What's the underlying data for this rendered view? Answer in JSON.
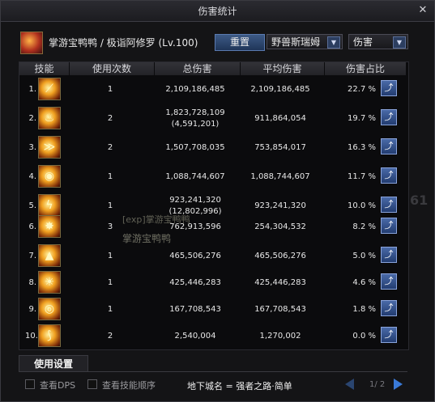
{
  "window": {
    "title": "伤害统计",
    "close": "✕"
  },
  "header": {
    "player": "掌游宝鸭鸭 / 极诣阿修罗 (Lv.100)",
    "reset_label": "重置",
    "dungeon_select": "野兽斯瑞姆",
    "type_select": "伤害"
  },
  "columns": [
    "技能",
    "使用次数",
    "总伤害",
    "平均伤害",
    "伤害占比"
  ],
  "rows": [
    {
      "rank": "1.",
      "uses": "1",
      "total": "2,109,186,485",
      "total_sub": "",
      "avg": "2,109,186,485",
      "pct": "22.7 %",
      "icon": "slash-icon"
    },
    {
      "rank": "2.",
      "uses": "2",
      "total": "1,823,728,109",
      "total_sub": "(4,591,201)",
      "avg": "911,864,054",
      "pct": "19.7 %",
      "icon": "flame-icon"
    },
    {
      "rank": "3.",
      "uses": "2",
      "total": "1,507,708,035",
      "total_sub": "",
      "avg": "753,854,017",
      "pct": "16.3 %",
      "icon": "wave-icon"
    },
    {
      "rank": "4.",
      "uses": "1",
      "total": "1,088,744,607",
      "total_sub": "",
      "avg": "1,088,744,607",
      "pct": "11.7 %",
      "icon": "eye-icon"
    },
    {
      "rank": "5.",
      "uses": "1",
      "total": "923,241,320",
      "total_sub": "(12,802,996)",
      "avg": "923,241,320",
      "pct": "10.0 %",
      "icon": "lightning-icon"
    },
    {
      "rank": "6.",
      "uses": "3",
      "total": "762,913,596",
      "total_sub": "",
      "avg": "254,304,532",
      "pct": "8.2 %",
      "icon": "burst-icon"
    },
    {
      "rank": "7.",
      "uses": "1",
      "total": "465,506,276",
      "total_sub": "",
      "avg": "465,506,276",
      "pct": "5.0 %",
      "icon": "pillar-icon"
    },
    {
      "rank": "8.",
      "uses": "1",
      "total": "425,446,283",
      "total_sub": "",
      "avg": "425,446,283",
      "pct": "4.6 %",
      "icon": "sun-icon"
    },
    {
      "rank": "9.",
      "uses": "1",
      "total": "167,708,543",
      "total_sub": "",
      "avg": "167,708,543",
      "pct": "1.8 %",
      "icon": "vortex-icon"
    },
    {
      "rank": "10.",
      "uses": "2",
      "total": "2,540,004",
      "total_sub": "",
      "avg": "1,270,002",
      "pct": "0.0 %",
      "icon": "blade-icon"
    }
  ],
  "background": {
    "label1": "[exp]掌游宝鸭鸭",
    "label2": "掌游宝鸭鸭",
    "num": "61"
  },
  "footer": {
    "settings_tab": "使用设置",
    "show_dps": "查看DPS",
    "show_order": "查看技能顺序",
    "dungeon_info": "地下城名 = 强者之路·简单",
    "page": "1/ 2"
  }
}
